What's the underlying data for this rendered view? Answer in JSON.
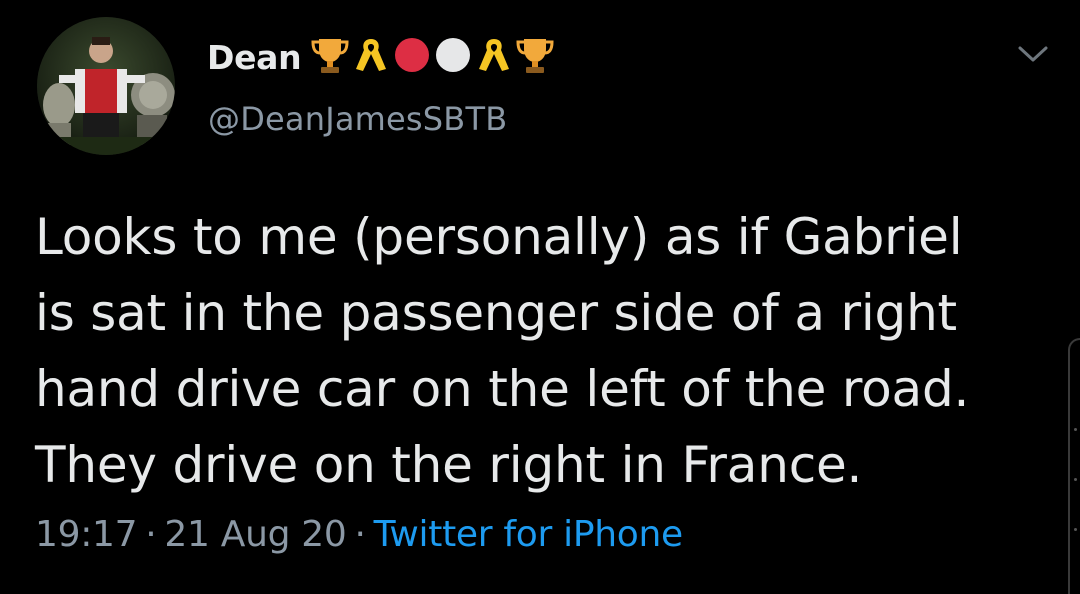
{
  "user": {
    "display_name": "Dean",
    "handle": "@DeanJamesSBTB",
    "name_emojis": [
      "trophy-icon",
      "yellow-ribbon-icon",
      "red-circle-icon",
      "white-circle-icon",
      "yellow-ribbon-icon",
      "trophy-icon"
    ]
  },
  "tweet": {
    "lines": [
      "Looks to me (personally) as if Gabriel",
      "is sat in the passenger side of a right",
      "hand drive car on the left of the road.",
      "They drive on the right in France."
    ],
    "time": "19:17",
    "separator": "·",
    "date": "21 Aug 20",
    "source": "Twitter for iPhone"
  },
  "colors": {
    "background": "#000000",
    "text": "#e7e9ea",
    "secondary": "#8b98a5",
    "link": "#1d9bf0"
  }
}
